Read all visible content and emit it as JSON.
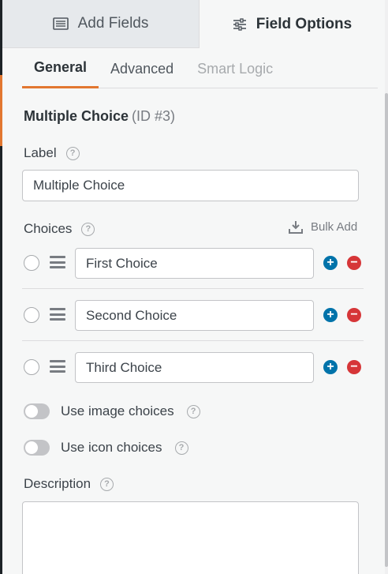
{
  "top_tabs": {
    "add_fields": {
      "label": "Add Fields",
      "icon": "list-icon"
    },
    "field_options": {
      "label": "Field Options",
      "icon": "sliders-icon"
    }
  },
  "sub_tabs": [
    "General",
    "Advanced",
    "Smart Logic"
  ],
  "field": {
    "type": "Multiple Choice",
    "id": "(ID #3)"
  },
  "label_section": {
    "label": "Label",
    "value": "Multiple Choice"
  },
  "choices_section": {
    "label": "Choices",
    "bulk_add": "Bulk Add",
    "items": [
      {
        "value": "First Choice"
      },
      {
        "value": "Second Choice"
      },
      {
        "value": "Third Choice"
      }
    ]
  },
  "toggles": {
    "image_choices": "Use image choices",
    "icon_choices": "Use icon choices"
  },
  "description": {
    "label": "Description",
    "value": ""
  },
  "colors": {
    "accent": "#e27730",
    "add": "#0073aa",
    "remove": "#d63638"
  }
}
